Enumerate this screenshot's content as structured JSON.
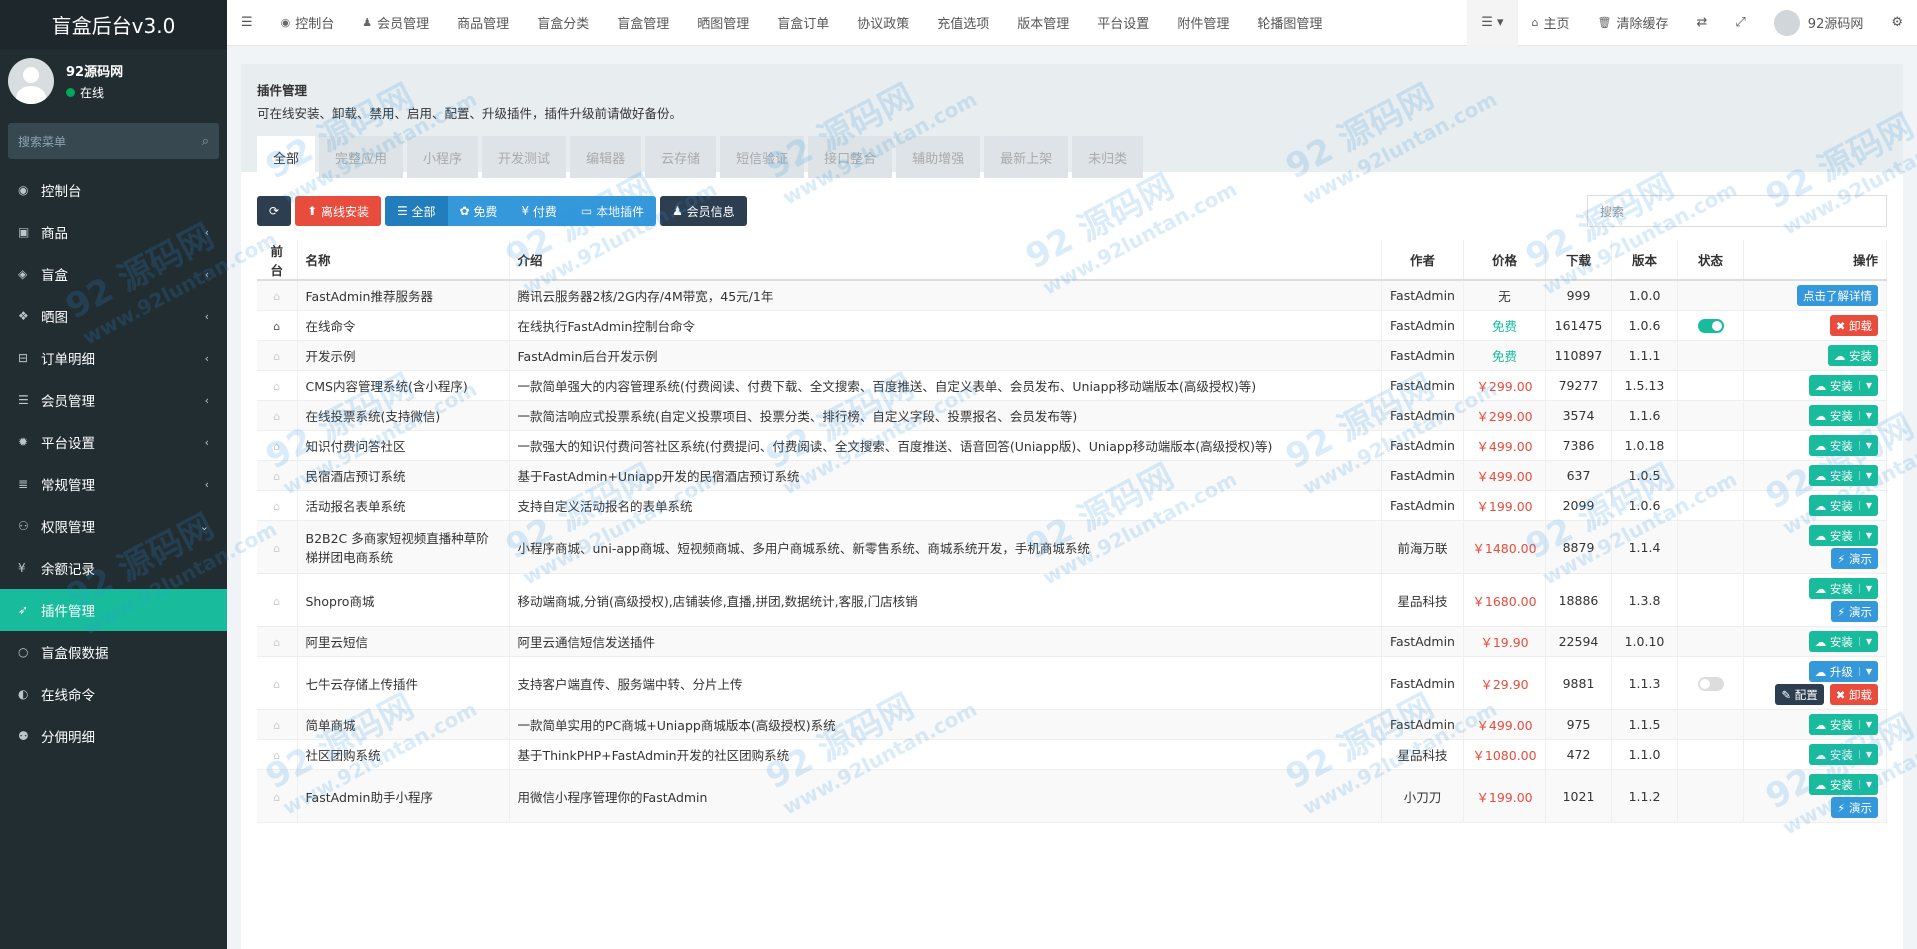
{
  "app": {
    "title": "盲盒后台v3.0"
  },
  "user": {
    "name": "92源码网",
    "status": "在线"
  },
  "sidebar": {
    "search_placeholder": "搜索菜单",
    "items": [
      {
        "label": "控制台",
        "icon": "dashboard-icon",
        "glyph": "◉",
        "arrow": ""
      },
      {
        "label": "商品",
        "icon": "briefcase-icon",
        "glyph": "▣",
        "arrow": "‹"
      },
      {
        "label": "盲盒",
        "icon": "cube-icon",
        "glyph": "◈",
        "arrow": "‹"
      },
      {
        "label": "晒图",
        "icon": "dropbox-icon",
        "glyph": "❖",
        "arrow": "‹"
      },
      {
        "label": "订单明细",
        "icon": "cart-icon",
        "glyph": "⊟",
        "arrow": "‹"
      },
      {
        "label": "会员管理",
        "icon": "list-icon",
        "glyph": "☰",
        "arrow": "‹"
      },
      {
        "label": "平台设置",
        "icon": "gear-icon",
        "glyph": "✹",
        "arrow": "‹"
      },
      {
        "label": "常规管理",
        "icon": "database-icon",
        "glyph": "≣",
        "arrow": "‹"
      },
      {
        "label": "权限管理",
        "icon": "group-icon",
        "glyph": "⚇",
        "arrow": "⌄"
      },
      {
        "label": "余额记录",
        "icon": "yen-icon",
        "glyph": "¥",
        "arrow": ""
      },
      {
        "label": "插件管理",
        "icon": "rocket-icon",
        "glyph": "➶",
        "arrow": ""
      },
      {
        "label": "盲盒假数据",
        "icon": "circle-icon",
        "glyph": "○",
        "arrow": ""
      },
      {
        "label": "在线命令",
        "icon": "adjust-icon",
        "glyph": "◐",
        "arrow": ""
      },
      {
        "label": "分佣明细",
        "icon": "users-icon",
        "glyph": "⚉",
        "arrow": ""
      }
    ]
  },
  "header": {
    "nav": [
      {
        "label": "控制台",
        "glyph": "◉"
      },
      {
        "label": "会员管理",
        "glyph": "♟"
      },
      {
        "label": "商品管理",
        "glyph": ""
      },
      {
        "label": "盲盒分类",
        "glyph": ""
      },
      {
        "label": "盲盒管理",
        "glyph": ""
      },
      {
        "label": "晒图管理",
        "glyph": ""
      },
      {
        "label": "盲盒订单",
        "glyph": ""
      },
      {
        "label": "协议政策",
        "glyph": ""
      },
      {
        "label": "充值选项",
        "glyph": ""
      },
      {
        "label": "版本管理",
        "glyph": ""
      },
      {
        "label": "平台设置",
        "glyph": ""
      },
      {
        "label": "附件管理",
        "glyph": ""
      },
      {
        "label": "轮播图管理",
        "glyph": ""
      }
    ],
    "home": "主页",
    "clear_cache": "清除缓存",
    "username": "92源码网"
  },
  "panel": {
    "title": "插件管理",
    "desc": "可在线安装、卸载、禁用、启用、配置、升级插件，插件升级前请做好备份。",
    "tabs": [
      "全部",
      "完整应用",
      "小程序",
      "开发测试",
      "编辑器",
      "云存储",
      "短信验证",
      "接口整合",
      "辅助增强",
      "最新上架",
      "未归类"
    ]
  },
  "toolbar": {
    "offline_install": "离线安装",
    "filter_all": "全部",
    "filter_free": "免费",
    "filter_paid": "付费",
    "filter_local": "本地插件",
    "member_info": "会员信息",
    "search_placeholder": "搜索"
  },
  "table": {
    "headers": [
      "前台",
      "名称",
      "介绍",
      "作者",
      "价格",
      "下载",
      "版本",
      "状态",
      "操作"
    ],
    "rows": [
      {
        "front": false,
        "name": "FastAdmin推荐服务器",
        "intro": "腾讯云服务器2核/2G内存/4M带宽，45元/1年",
        "author": "FastAdmin",
        "price": "无",
        "ptype": "none",
        "downloads": "999",
        "version": "1.0.0",
        "status": "",
        "actions": [
          {
            "label": "点击了解详情",
            "cls": "ab-blue",
            "caret": false
          }
        ]
      },
      {
        "front": true,
        "name": "在线命令",
        "intro": "在线执行FastAdmin控制台命令",
        "author": "FastAdmin",
        "price": "免费",
        "ptype": "free",
        "downloads": "161475",
        "version": "1.0.6",
        "status": "on",
        "actions": [
          {
            "label": "✖ 卸载",
            "cls": "ab-red",
            "caret": false
          }
        ]
      },
      {
        "front": false,
        "name": "开发示例",
        "intro": "FastAdmin后台开发示例",
        "author": "FastAdmin",
        "price": "免费",
        "ptype": "free",
        "downloads": "110897",
        "version": "1.1.1",
        "status": "",
        "actions": [
          {
            "label": "☁ 安装",
            "cls": "ab-green",
            "caret": false
          }
        ]
      },
      {
        "front": false,
        "name": "CMS内容管理系统(含小程序)",
        "intro": "一款简单强大的内容管理系统(付费阅读、付费下载、全文搜索、百度推送、自定义表单、会员发布、Uniapp移动端版本(高级授权)等)",
        "author": "FastAdmin",
        "price": "￥299.00",
        "ptype": "paid",
        "downloads": "79277",
        "version": "1.5.13",
        "status": "",
        "actions": [
          {
            "label": "☁ 安装",
            "cls": "ab-green",
            "caret": true
          }
        ]
      },
      {
        "front": false,
        "name": "在线投票系统(支持微信)",
        "intro": "一款简洁响应式投票系统(自定义投票项目、投票分类、排行榜、自定义字段、投票报名、会员发布等)",
        "author": "FastAdmin",
        "price": "￥299.00",
        "ptype": "paid",
        "downloads": "3574",
        "version": "1.1.6",
        "status": "",
        "actions": [
          {
            "label": "☁ 安装",
            "cls": "ab-green",
            "caret": true
          }
        ]
      },
      {
        "front": false,
        "name": "知识付费问答社区",
        "intro": "一款强大的知识付费问答社区系统(付费提问、付费阅读、全文搜索、百度推送、语音回答(Uniapp版)、Uniapp移动端版本(高级授权)等)",
        "author": "FastAdmin",
        "price": "￥499.00",
        "ptype": "paid",
        "downloads": "7386",
        "version": "1.0.18",
        "status": "",
        "actions": [
          {
            "label": "☁ 安装",
            "cls": "ab-green",
            "caret": true
          }
        ]
      },
      {
        "front": false,
        "name": "民宿酒店预订系统",
        "intro": "基于FastAdmin+Uniapp开发的民宿酒店预订系统",
        "author": "FastAdmin",
        "price": "￥499.00",
        "ptype": "paid",
        "downloads": "637",
        "version": "1.0.5",
        "status": "",
        "actions": [
          {
            "label": "☁ 安装",
            "cls": "ab-green",
            "caret": true
          }
        ]
      },
      {
        "front": false,
        "name": "活动报名表单系统",
        "intro": "支持自定义活动报名的表单系统",
        "author": "FastAdmin",
        "price": "￥199.00",
        "ptype": "paid",
        "downloads": "2099",
        "version": "1.0.6",
        "status": "",
        "actions": [
          {
            "label": "☁ 安装",
            "cls": "ab-green",
            "caret": true
          }
        ]
      },
      {
        "front": false,
        "name": "B2B2C 多商家短视频直播种草阶梯拼团电商系统",
        "intro": "小程序商城、uni-app商城、短视频商城、多用户商城系统、新零售系统、商城系统开发，手机商城系统",
        "author": "前海万联",
        "price": "￥1480.00",
        "ptype": "paid",
        "downloads": "8879",
        "version": "1.1.4",
        "status": "",
        "actions": [
          {
            "label": "☁ 安装",
            "cls": "ab-green",
            "caret": true
          },
          {
            "label": "⚡ 演示",
            "cls": "ab-blue",
            "caret": false
          }
        ]
      },
      {
        "front": false,
        "name": "Shopro商城",
        "intro": "移动端商城,分销(高级授权),店铺装修,直播,拼团,数据统计,客服,门店核销",
        "author": "星品科技",
        "price": "￥1680.00",
        "ptype": "paid",
        "downloads": "18886",
        "version": "1.3.8",
        "status": "",
        "actions": [
          {
            "label": "☁ 安装",
            "cls": "ab-green",
            "caret": true
          },
          {
            "label": "⚡ 演示",
            "cls": "ab-blue",
            "caret": false
          }
        ]
      },
      {
        "front": false,
        "name": "阿里云短信",
        "intro": "阿里云通信短信发送插件",
        "author": "FastAdmin",
        "price": "￥19.90",
        "ptype": "paid",
        "downloads": "22594",
        "version": "1.0.10",
        "status": "",
        "actions": [
          {
            "label": "☁ 安装",
            "cls": "ab-green",
            "caret": true
          }
        ]
      },
      {
        "front": false,
        "name": "七牛云存储上传插件",
        "intro": "支持客户端直传、服务端中转、分片上传",
        "author": "FastAdmin",
        "price": "￥29.90",
        "ptype": "paid",
        "downloads": "9881",
        "version": "1.1.3",
        "status": "off",
        "actions": [
          {
            "label": "☁ 升级",
            "cls": "ab-blue",
            "caret": true
          },
          {
            "label": "✎ 配置",
            "cls": "ab-dark",
            "caret": false
          },
          {
            "label": "✖ 卸载",
            "cls": "ab-red",
            "caret": false
          }
        ]
      },
      {
        "front": false,
        "name": "简单商城",
        "intro": "一款简单实用的PC商城+Uniapp商城版本(高级授权)系统",
        "author": "FastAdmin",
        "price": "￥499.00",
        "ptype": "paid",
        "downloads": "975",
        "version": "1.1.5",
        "status": "",
        "actions": [
          {
            "label": "☁ 安装",
            "cls": "ab-green",
            "caret": true
          }
        ]
      },
      {
        "front": false,
        "name": "社区团购系统",
        "intro": "基于ThinkPHP+FastAdmin开发的社区团购系统",
        "author": "星品科技",
        "price": "￥1080.00",
        "ptype": "paid",
        "downloads": "472",
        "version": "1.1.0",
        "status": "",
        "actions": [
          {
            "label": "☁ 安装",
            "cls": "ab-green",
            "caret": true
          }
        ]
      },
      {
        "front": false,
        "name": "FastAdmin助手小程序",
        "intro": "用微信小程序管理你的FastAdmin",
        "author": "小刀刀",
        "price": "￥199.00",
        "ptype": "paid",
        "downloads": "1021",
        "version": "1.1.2",
        "status": "",
        "actions": [
          {
            "label": "☁ 安装",
            "cls": "ab-green",
            "caret": true
          },
          {
            "label": "⚡ 演示",
            "cls": "ab-blue",
            "caret": false
          }
        ]
      }
    ]
  },
  "watermark": {
    "line1": "92 源码网",
    "line2": "www.92luntan.com"
  }
}
